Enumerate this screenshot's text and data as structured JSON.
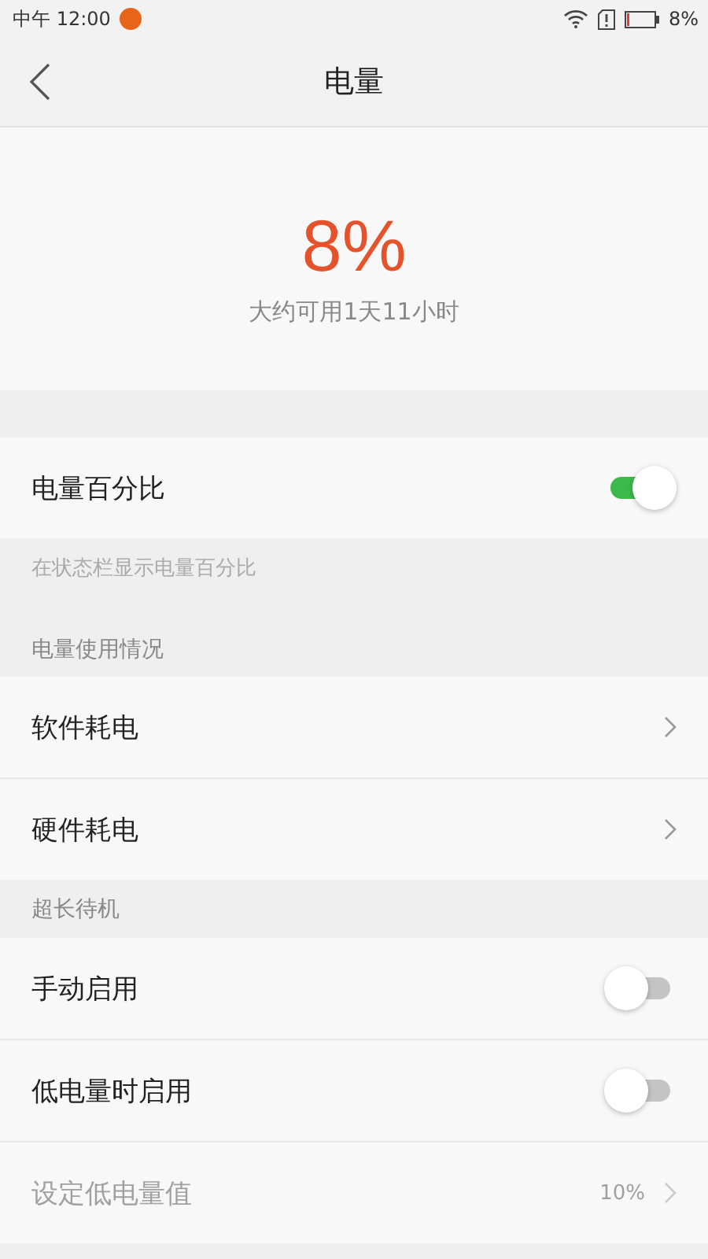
{
  "status_bar": {
    "time": "中午 12:00",
    "battery_text": "8%"
  },
  "header": {
    "title": "电量"
  },
  "summary": {
    "percent": "8%",
    "estimate": "大约可用1天11小时"
  },
  "sections": [
    {
      "rows": [
        {
          "kind": "toggle",
          "label": "电量百分比",
          "on": true
        }
      ],
      "footer": "在状态栏显示电量百分比"
    },
    {
      "title": "电量使用情况",
      "rows": [
        {
          "kind": "link",
          "label": "软件耗电"
        },
        {
          "kind": "link",
          "label": "硬件耗电"
        }
      ]
    },
    {
      "title": "超长待机",
      "rows": [
        {
          "kind": "toggle",
          "label": "手动启用",
          "on": false
        },
        {
          "kind": "toggle",
          "label": "低电量时启用",
          "on": false
        },
        {
          "kind": "value",
          "label": "设定低电量值",
          "value": "10%",
          "disabled": true
        }
      ]
    }
  ]
}
